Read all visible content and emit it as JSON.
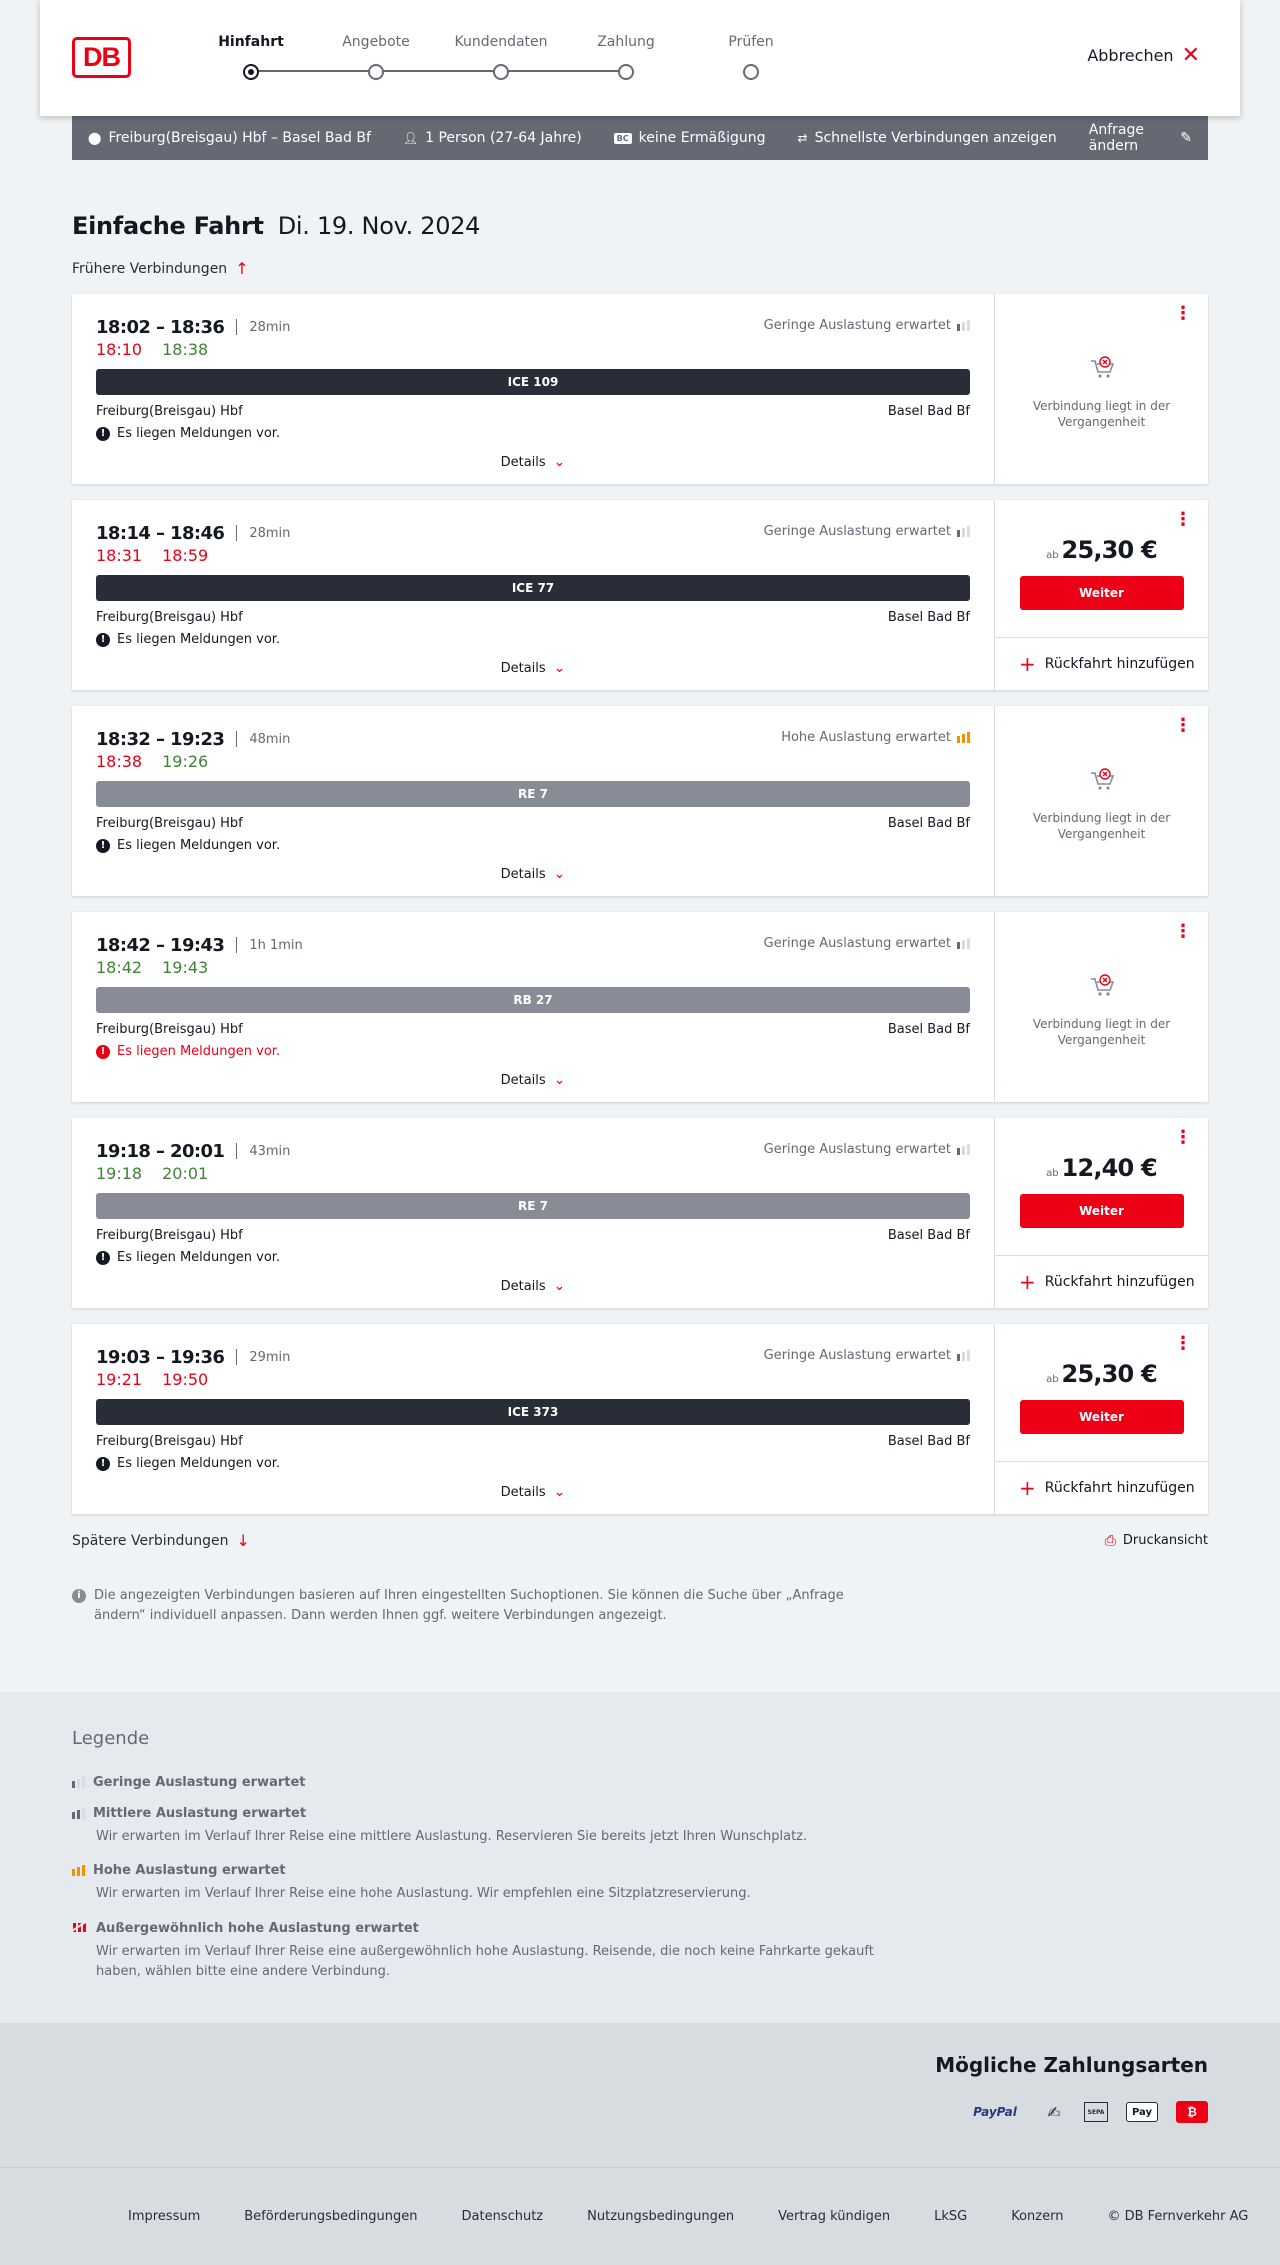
{
  "header": {
    "logo": "DB",
    "steps": [
      "Hinfahrt",
      "Angebote",
      "Kundendaten",
      "Zahlung",
      "Prüfen"
    ],
    "active_step": "Hinfahrt",
    "cancel_label": "Abbrechen"
  },
  "search": {
    "route": "Freiburg(Breisgau) Hbf – Basel Bad Bf",
    "travellers": "1 Person (27-64 Jahre)",
    "discount_badge": "BC",
    "discount": "keine Ermäßigung",
    "fastest": "Schnellste Verbindungen anzeigen",
    "change": "Anfrage ändern"
  },
  "main": {
    "title": "Einfache Fahrt",
    "date": "Di. 19. Nov. 2024",
    "earlier": "Frühere Verbindungen",
    "later": "Spätere Verbindungen",
    "print": "Druckansicht",
    "info": "Die angezeigten Verbindungen basieren auf Ihren eingestellten Suchoptionen. Sie können die Suche über „Anfrage ändern“ individuell anpassen. Dann werden Ihnen ggf. weitere Verbindungen angezeigt."
  },
  "connections": [
    {
      "time": "18:02 – 18:36",
      "duration": "28min",
      "dep_rt": "18:10",
      "arr_rt": "18:38",
      "dep_late": true,
      "arr_late": false,
      "load": "Geringe Auslastung erwartet",
      "load_level": 1,
      "train": "ICE 109",
      "kind": "ice",
      "from": "Freiburg(Breisgau) Hbf",
      "to": "Basel Bad Bf",
      "message": "Es liegen Meldungen vor.",
      "msg_red": false,
      "details": "Details",
      "past": true,
      "past_text": "Verbindung liegt in der Vergangenheit"
    },
    {
      "time": "18:14 – 18:46",
      "duration": "28min",
      "dep_rt": "18:31",
      "arr_rt": "18:59",
      "dep_late": true,
      "arr_late": true,
      "load": "Geringe Auslastung erwartet",
      "load_level": 1,
      "train": "ICE 77",
      "kind": "ice",
      "from": "Freiburg(Breisgau) Hbf",
      "to": "Basel Bad Bf",
      "message": "Es liegen Meldungen vor.",
      "msg_red": false,
      "details": "Details",
      "past": false,
      "price_prefix": "ab",
      "price": "25,30 €",
      "button": "Weiter",
      "return_label": "Rückfahrt hinzufügen"
    },
    {
      "time": "18:32 – 19:23",
      "duration": "48min",
      "dep_rt": "18:38",
      "arr_rt": "19:26",
      "dep_late": true,
      "arr_late": false,
      "load": "Hohe Auslastung erwartet",
      "load_level": 3,
      "train": "RE 7",
      "kind": "re",
      "from": "Freiburg(Breisgau) Hbf",
      "to": "Basel Bad Bf",
      "message": "Es liegen Meldungen vor.",
      "msg_red": false,
      "details": "Details",
      "past": true,
      "past_text": "Verbindung liegt in der Vergangenheit"
    },
    {
      "time": "18:42 – 19:43",
      "duration": "1h 1min",
      "dep_rt": "18:42",
      "arr_rt": "19:43",
      "dep_late": false,
      "arr_late": false,
      "load": "Geringe Auslastung erwartet",
      "load_level": 1,
      "train": "RB 27",
      "kind": "re",
      "from": "Freiburg(Breisgau) Hbf",
      "to": "Basel Bad Bf",
      "message": "Es liegen Meldungen vor.",
      "msg_red": true,
      "details": "Details",
      "past": true,
      "past_text": "Verbindung liegt in der Vergangenheit"
    },
    {
      "time": "19:18 – 20:01",
      "duration": "43min",
      "dep_rt": "19:18",
      "arr_rt": "20:01",
      "dep_late": false,
      "arr_late": false,
      "load": "Geringe Auslastung erwartet",
      "load_level": 1,
      "train": "RE 7",
      "kind": "re",
      "from": "Freiburg(Breisgau) Hbf",
      "to": "Basel Bad Bf",
      "message": "Es liegen Meldungen vor.",
      "msg_red": false,
      "details": "Details",
      "past": false,
      "price_prefix": "ab",
      "price": "12,40 €",
      "button": "Weiter",
      "return_label": "Rückfahrt hinzufügen"
    },
    {
      "time": "19:03 – 19:36",
      "duration": "29min",
      "dep_rt": "19:21",
      "arr_rt": "19:50",
      "dep_late": true,
      "arr_late": true,
      "load": "Geringe Auslastung erwartet",
      "load_level": 1,
      "train": "ICE 373",
      "kind": "ice",
      "from": "Freiburg(Breisgau) Hbf",
      "to": "Basel Bad Bf",
      "message": "Es liegen Meldungen vor.",
      "msg_red": false,
      "details": "Details",
      "past": false,
      "price_prefix": "ab",
      "price": "25,30 €",
      "button": "Weiter",
      "return_label": "Rückfahrt hinzufügen"
    }
  ],
  "legend": {
    "title": "Legende",
    "items": [
      {
        "title": "Geringe Auslastung erwartet",
        "desc": "",
        "level": 1
      },
      {
        "title": "Mittlere Auslastung erwartet",
        "desc": "Wir erwarten im Verlauf Ihrer Reise eine mittlere Auslastung. Reservieren Sie bereits jetzt Ihren Wunschplatz.",
        "level": 2
      },
      {
        "title": "Hohe Auslastung erwartet",
        "desc": "Wir erwarten im Verlauf Ihrer Reise eine hohe Auslastung. Wir empfehlen eine Sitzplatzreservierung.",
        "level": 3
      },
      {
        "title": "Außergewöhnlich hohe Auslastung erwartet",
        "desc": "Wir erwarten im Verlauf Ihrer Reise eine außergewöhnlich hohe Auslastung. Reisende, die noch keine Fahrkarte gekauft haben, wählen bitte eine andere Verbindung.",
        "level": 4
      }
    ]
  },
  "payment": {
    "title": "Mögliche Zahlungsarten",
    "methods": [
      "PayPal",
      "SEPA",
      "Pay",
      "DB"
    ]
  },
  "footer": {
    "links": [
      "Impressum",
      "Beförderungsbedingungen",
      "Datenschutz",
      "Nutzungsbedingungen",
      "Vertrag kündigen",
      "LkSG",
      "Konzern"
    ],
    "copyright": "© DB Fernverkehr AG"
  },
  "colors": {
    "accent": "#ec0016",
    "late": "#ec0016",
    "ontime": "#408335",
    "bar_dark": "#282d37",
    "bar_grey": "#878c96",
    "high_load": "#f39200"
  }
}
